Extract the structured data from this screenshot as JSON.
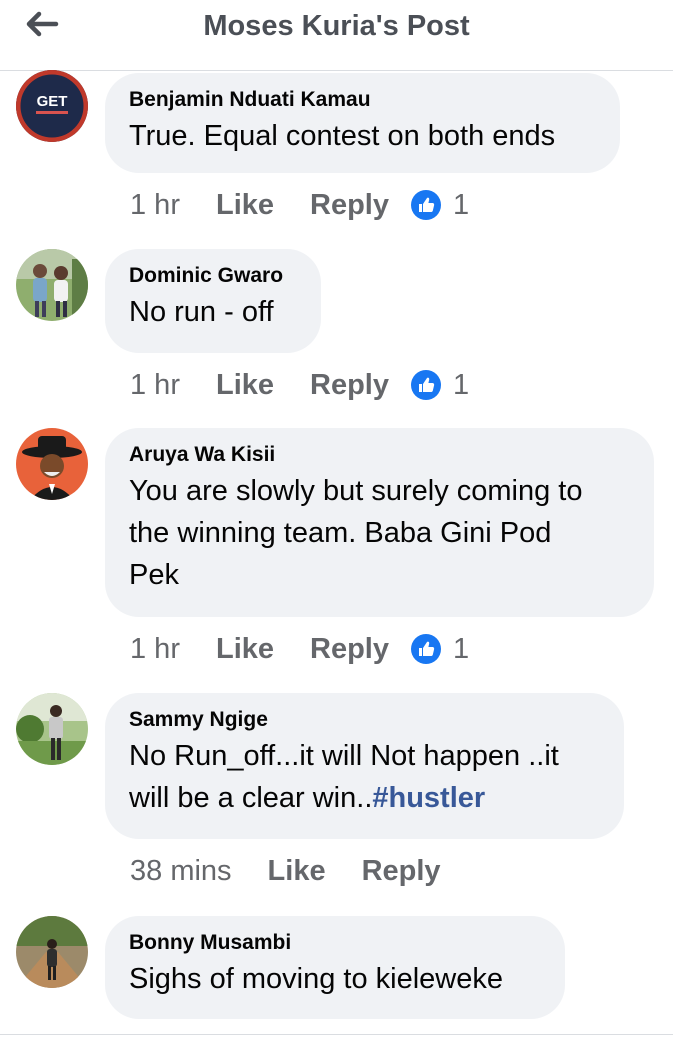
{
  "header": {
    "title": "Moses Kuria's Post",
    "back_icon": "arrow-left-icon"
  },
  "avatars": {
    "badge_text": "GET"
  },
  "comments": [
    {
      "author": "Benjamin Nduati Kamau",
      "text": "True. Equal contest on both ends",
      "time": "1 hr",
      "like_label": "Like",
      "reply_label": "Reply",
      "reaction_count": "1"
    },
    {
      "author": "Dominic Gwaro",
      "text": "No run - off",
      "time": "1 hr",
      "like_label": "Like",
      "reply_label": "Reply",
      "reaction_count": "1"
    },
    {
      "author": "Aruya Wa Kisii",
      "text_lines": [
        "You are slowly but surely coming to",
        "the winning team. Baba Gini Pod",
        "Pek"
      ],
      "time": "1 hr",
      "like_label": "Like",
      "reply_label": "Reply",
      "reaction_count": "1"
    },
    {
      "author": "Sammy Ngige",
      "text_line1": "No Run_off...it will Not happen ..it",
      "text_line2_prefix": "will be a clear win..",
      "hashtag": "#hustler",
      "time": "38 mins",
      "like_label": "Like",
      "reply_label": "Reply"
    },
    {
      "author": "Bonny Musambi",
      "text": "Sighs of moving to kieleweke"
    }
  ],
  "colors": {
    "bubble": "#f0f2f5",
    "meta_text": "#65676b",
    "like_blue": "#1877f2",
    "hashtag": "#385898"
  }
}
